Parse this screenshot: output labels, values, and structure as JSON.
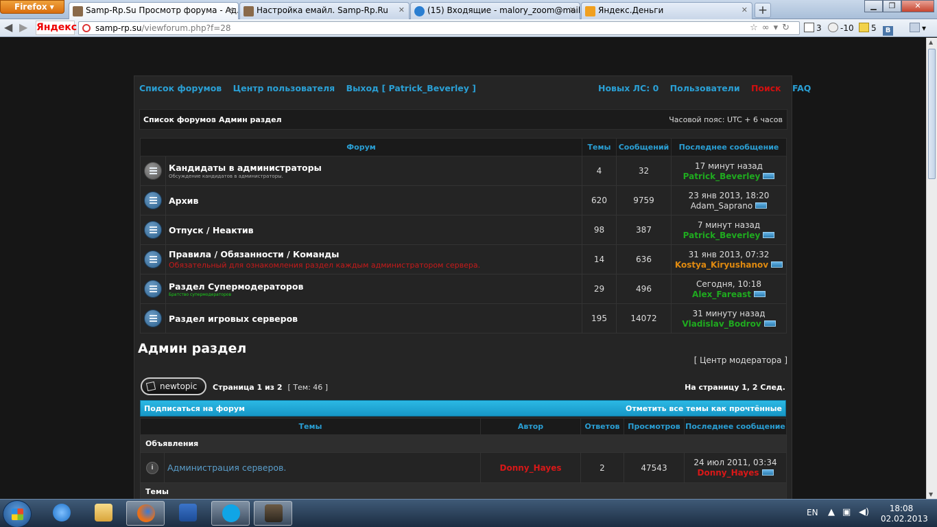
{
  "browser": {
    "menu_label": "Firefox",
    "tabs": [
      {
        "title": "Samp-Rp.Su Просмотр форума - Ад..."
      },
      {
        "title": "Настройка емайл. Samp-Rp.Ru"
      },
      {
        "title": "(15) Входящие - malory_zoom@mail...."
      },
      {
        "title": "Яндекс.Деньги"
      }
    ],
    "new_tab_label": "+",
    "url_host": "samp-rp.su",
    "url_path": "/viewforum.php?f=28",
    "yandex_label": "Яндекс",
    "mail_count": "3",
    "weather": "-10",
    "notes_count": "5"
  },
  "forum": {
    "nav": {
      "forum_list": "Список форумов",
      "user_center": "Центр пользователя",
      "logout": "Выход [ Patrick_Beverley ]",
      "new_pm": "Новых ЛС: 0",
      "users": "Пользователи",
      "search": "Поиск",
      "faq": "FAQ"
    },
    "breadcrumb": {
      "root": "Список форумов",
      "current": "Админ раздел"
    },
    "timezone": "Часовой пояс: UTC + 6 часов",
    "subforum_headers": {
      "forum": "Форум",
      "topics": "Темы",
      "posts": "Сообщений",
      "last_post": "Последнее сообщение"
    },
    "subforums": [
      {
        "title": "Кандидаты в администраторы",
        "desc": "Обсуждение кандидатов в администраторы.",
        "topics": "4",
        "posts": "32",
        "last_date": "17 минут назад",
        "last_user": "Patrick_Beverley"
      },
      {
        "title": "Архив",
        "desc": "",
        "topics": "620",
        "posts": "9759",
        "last_date": "23 янв 2013, 18:20",
        "last_user": "Adam_Saprano"
      },
      {
        "title": "Отпуск / Неактив",
        "desc": "",
        "topics": "98",
        "posts": "387",
        "last_date": "7 минут назад",
        "last_user": "Patrick_Beverley"
      },
      {
        "title": "Правила / Обязанности / Команды",
        "desc": "Обязательный для ознакомления раздел каждым администратором сервера.",
        "topics": "14",
        "posts": "636",
        "last_date": "31 янв 2013, 07:32",
        "last_user": "Kostya_Kiryushanov"
      },
      {
        "title": "Раздел Супермодераторов",
        "desc": "Братство супермодераторов",
        "topics": "29",
        "posts": "496",
        "last_date": "Сегодня, 10:18",
        "last_user": "Alex_Fareast"
      },
      {
        "title": "Раздел игровых серверов",
        "desc": "",
        "topics": "195",
        "posts": "14072",
        "last_date": "31 минуту назад",
        "last_user": "Vladislav_Bodrov"
      }
    ],
    "section_title": "Админ раздел",
    "mod_center": "[ Центр модератора ]",
    "new_topic_label": "newtopic",
    "page_info": "Страница 1 из 2",
    "topic_count": "[ Тем: 46 ]",
    "pagination": "На страницу 1, 2  След.",
    "subscribe": "Подписаться на форум",
    "mark_read": "Отметить все темы как прочтённые",
    "topic_headers": {
      "topics": "Темы",
      "author": "Автор",
      "replies": "Ответов",
      "views": "Просмотров",
      "last_post": "Последнее сообщение"
    },
    "announcements_label": "Объявления",
    "announcement": {
      "title": "Администрация серверов.",
      "author": "Donny_Hayes",
      "replies": "2",
      "views": "47543",
      "last_date": "24 июл 2011, 03:34",
      "last_user": "Donny_Hayes"
    },
    "topics_label": "Темы"
  },
  "taskbar": {
    "lang": "EN",
    "time": "18:08",
    "date": "02.02.2013"
  }
}
